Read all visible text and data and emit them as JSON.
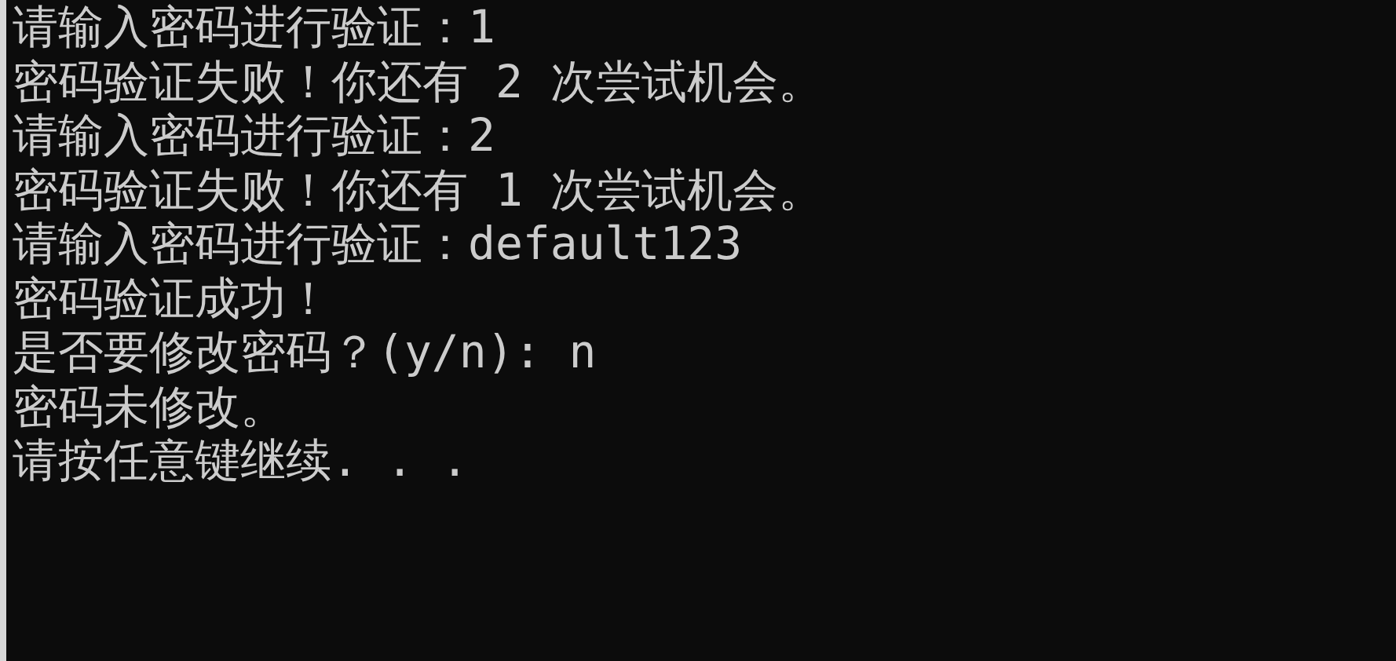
{
  "console": {
    "lines": [
      "请输入密码进行验证：1",
      "密码验证失败！你还有 2 次尝试机会。",
      "请输入密码进行验证：2",
      "密码验证失败！你还有 1 次尝试机会。",
      "请输入密码进行验证：default123",
      "密码验证成功！",
      "是否要修改密码？(y/n): n",
      "密码未修改。",
      "请按任意键继续. . ."
    ]
  }
}
